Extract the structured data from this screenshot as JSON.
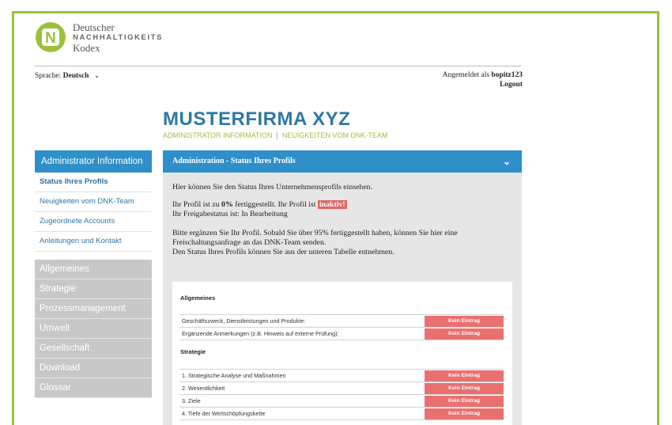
{
  "brand": {
    "line1": "Deutscher",
    "line2": "NACHHALTIGKEITS",
    "line3": "Kodex",
    "logo_letter": "N",
    "colors": {
      "green": "#9bc13c",
      "blue": "#2f8fc8",
      "title_blue": "#2f78a6",
      "red": "#ea7070"
    }
  },
  "language": {
    "label": "Sprache:",
    "value": "Deutsch",
    "icon": "chevron-down-icon"
  },
  "login": {
    "prefix": "Angemeldet als",
    "user": "bopitz123",
    "logout": "Logout"
  },
  "company": {
    "title": "MUSTERFIRMA XYZ"
  },
  "sublinks": {
    "admin": "ADMINISTRATOR INFORMATION",
    "separator": "|",
    "news": "NEUIGKEITEN VOM DNK-TEAM"
  },
  "sidebar": {
    "header": "Administrator Information",
    "links": [
      {
        "label": "Status Ihres Profils"
      },
      {
        "label": "Neuigkeiten vom DNK-Team"
      },
      {
        "label": "Zugeordnete Accounts"
      },
      {
        "label": "Anleitungen und Kontakt"
      }
    ],
    "categories": [
      {
        "label": "Allgemeines"
      },
      {
        "label": "Strategie"
      },
      {
        "label": "Prozessmanagement"
      },
      {
        "label": "Umwelt"
      },
      {
        "label": "Gesellschaft"
      },
      {
        "label": "Download"
      },
      {
        "label": "Glossar"
      }
    ]
  },
  "panel": {
    "title": "Administration - Status Ihres Profils",
    "intro": "Hier können Sie den Status Ihres Unternehmensprofils einsehen.",
    "profile_pre": "Ihr Profil ist zu ",
    "profile_pct": "0%",
    "profile_mid": " fertiggestellt. Ihr Profil ist ",
    "profile_status": "inaktiv!",
    "release": "Ihr Freigabestatus ist:  In Bearbeitung",
    "info1": "Bitte ergänzen Sie Ihr Profil. Sobald Sie über 95% fertiggestellt haben, können Sie hier eine",
    "info2": "Freischaltungsanfrage an das DNK-Team senden.",
    "info3": "Den Status Ihres Profils können Sie aus der unteren Tabelle entnehmen."
  },
  "sections": [
    {
      "title": "Allgemeines",
      "rows": [
        {
          "label": "Geschäftszweck, Dienstleistungen und Produkte:",
          "status": "Kein Eintrag"
        },
        {
          "label": "Ergänzende Anmerkungen (z.B. Hinweis auf externe Prüfung):",
          "status": "Kein Eintrag"
        }
      ]
    },
    {
      "title": "Strategie",
      "rows": [
        {
          "label": "1. Strategische Analyse und Maßnahmen",
          "status": "Kein Eintrag"
        },
        {
          "label": "2. Wesentlichkeit",
          "status": "Kein Eintrag"
        },
        {
          "label": "3. Ziele",
          "status": "Kein Eintrag"
        },
        {
          "label": "4. Tiefe der Wertschöpfungskette",
          "status": "Kein Eintrag"
        }
      ]
    }
  ]
}
